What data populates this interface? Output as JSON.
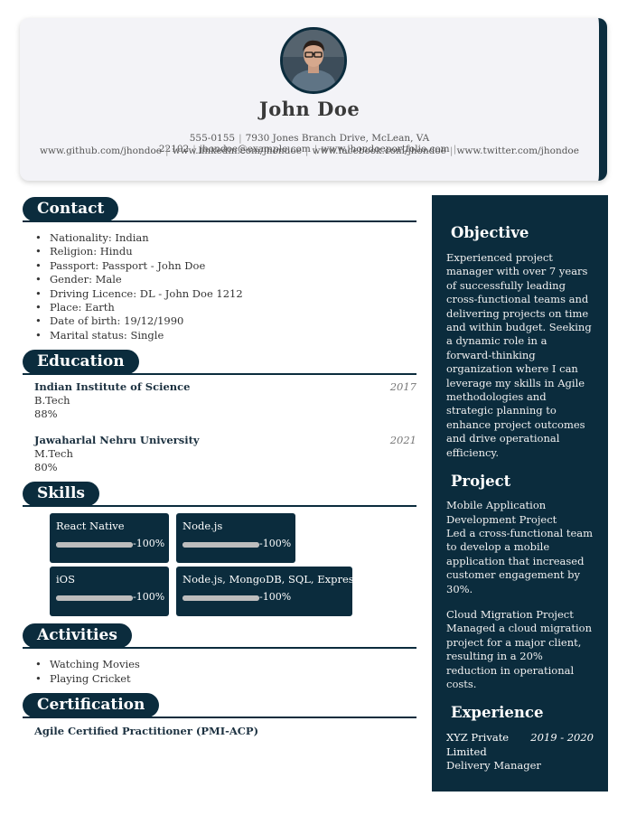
{
  "header": {
    "name": "John Doe",
    "phone": "555-0155",
    "address": "7930 Jones Branch Drive, McLean, VA 22102",
    "email": "jhondoe@example.com",
    "portfolio": "www.jhondoeportfolio.com",
    "github": "www.github.com/jhondoe",
    "linkedin": "www.linkedin.com/jhondoe",
    "facebook": "www.facebook.com/jhondoe",
    "twitter": "www.twitter.com/jhondoe",
    "separator": "|"
  },
  "contact": {
    "title": "Contact",
    "items": [
      "Nationality: Indian",
      "Religion: Hindu",
      "Passport: Passport - John Doe",
      "Gender: Male",
      "Driving Licence: DL - John Doe 1212",
      "Place: Earth",
      "Date of birth: 19/12/1990",
      "Marital status: Single"
    ]
  },
  "education": {
    "title": "Education",
    "items": [
      {
        "institution": "Indian Institute of Science",
        "degree": "B.Tech",
        "score": "88%",
        "year": "2017"
      },
      {
        "institution": "Jawaharlal Nehru University",
        "degree": "M.Tech",
        "score": "80%",
        "year": "2021"
      }
    ]
  },
  "skills": {
    "title": "Skills",
    "items": [
      {
        "name": "React Native",
        "level": 100,
        "level_label": "-100%"
      },
      {
        "name": "Node.js",
        "level": 100,
        "level_label": "-100%"
      },
      {
        "name": "iOS",
        "level": 100,
        "level_label": "-100%"
      },
      {
        "name": "Node.js, MongoDB, SQL, Express",
        "level": 100,
        "level_label": "-100%"
      }
    ]
  },
  "activities": {
    "title": "Activities",
    "items": [
      "Watching Movies",
      "Playing Cricket"
    ]
  },
  "certification": {
    "title": "Certification",
    "items": [
      "Agile Certified Practitioner (PMI-ACP)"
    ]
  },
  "objective": {
    "title": "Objective",
    "text": "Experienced project manager with over 7 years of successfully leading cross-functional teams and delivering projects on time and within budget. Seeking a dynamic role in a forward-thinking organization where I can leverage my skills in Agile methodologies and strategic planning to enhance project outcomes and drive operational efficiency."
  },
  "project": {
    "title": "Project",
    "items": [
      {
        "name": "Mobile Application Development Project",
        "description": "Led a cross-functional team to develop a mobile application that increased customer engagement by 30%."
      },
      {
        "name": "Cloud Migration Project",
        "description": "Managed a cloud migration project for a major client, resulting in a 20% reduction in operational costs."
      }
    ]
  },
  "experience": {
    "title": "Experience",
    "items": [
      {
        "company": "XYZ Private Limited",
        "years": "2019 - 2020",
        "role": "Delivery Manager"
      }
    ]
  },
  "colors": {
    "accent": "#0b2c3d",
    "header_bg": "#f3f3f7"
  }
}
